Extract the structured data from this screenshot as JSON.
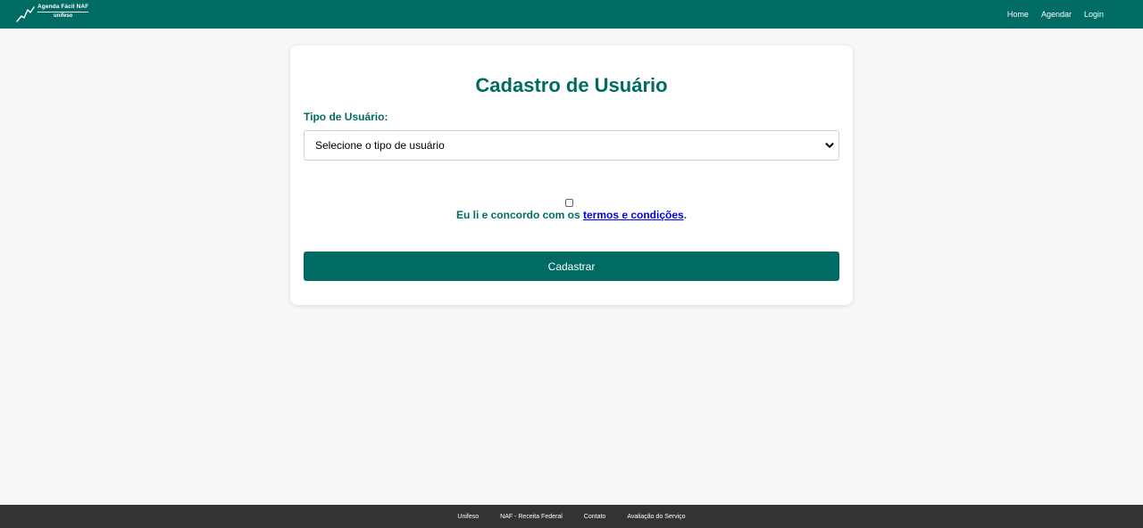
{
  "header": {
    "logo": {
      "title": "Agenda Fácil NAF",
      "subtitle": "unifeso"
    },
    "nav": [
      {
        "label": "Home"
      },
      {
        "label": "Agendar"
      },
      {
        "label": "Login"
      }
    ]
  },
  "form": {
    "title": "Cadastro de Usuário",
    "user_type_label": "Tipo de Usuário:",
    "user_type_select": {
      "selected": "Selecione o tipo de usuário",
      "icon": "chevron-down-icon"
    },
    "terms": {
      "checked": false,
      "prefix": "Eu li e concordo com os ",
      "link_text": "termos e condições",
      "suffix": "."
    },
    "submit_label": "Cadastrar"
  },
  "footer": {
    "links": [
      {
        "label": "Unifeso"
      },
      {
        "label": "NAF - Receita Federal"
      },
      {
        "label": "Contato"
      },
      {
        "label": "Avaliação do Serviço"
      }
    ]
  },
  "colors": {
    "brand": "#006b63",
    "page_background": "#f8f8f8",
    "footer_background": "#333333",
    "link": "#0000ee"
  }
}
